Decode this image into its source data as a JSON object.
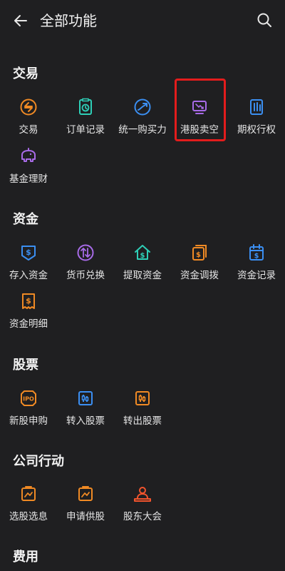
{
  "header": {
    "title": "全部功能"
  },
  "sections": {
    "trade": {
      "title": "交易",
      "items": [
        {
          "label": "交易",
          "icon": "swap-circle-icon",
          "color": "#f08a24"
        },
        {
          "label": "订单记录",
          "icon": "clock-doc-icon",
          "color": "#2ecfb7"
        },
        {
          "label": "统一购买力",
          "icon": "power-circle-icon",
          "color": "#3b8ff2"
        },
        {
          "label": "港股卖空",
          "icon": "short-chart-icon",
          "color": "#a86be8"
        },
        {
          "label": "期权行权",
          "icon": "option-exercise-icon",
          "color": "#3b8ff2"
        },
        {
          "label": "基金理财",
          "icon": "fund-piggy-icon",
          "color": "#a86be8"
        }
      ]
    },
    "funds": {
      "title": "资金",
      "items": [
        {
          "label": "存入资金",
          "icon": "deposit-icon",
          "color": "#3b8ff2"
        },
        {
          "label": "货币兑换",
          "icon": "currency-exchange-icon",
          "color": "#a86be8"
        },
        {
          "label": "提取资金",
          "icon": "withdraw-house-icon",
          "color": "#2ecfb7"
        },
        {
          "label": "资金调拨",
          "icon": "transfer-icon",
          "color": "#f08a24"
        },
        {
          "label": "资金记录",
          "icon": "calendar-dollar-icon",
          "color": "#3b8ff2"
        },
        {
          "label": "资金明细",
          "icon": "dollar-doc-icon",
          "color": "#f08a24"
        }
      ]
    },
    "stocks": {
      "title": "股票",
      "items": [
        {
          "label": "新股申购",
          "icon": "ipo-icon",
          "color": "#f08a24"
        },
        {
          "label": "转入股票",
          "icon": "stock-in-icon",
          "color": "#3b8ff2"
        },
        {
          "label": "转出股票",
          "icon": "stock-out-icon",
          "color": "#f08a24"
        }
      ]
    },
    "corporate": {
      "title": "公司行动",
      "items": [
        {
          "label": "选股选息",
          "icon": "chart-doc-icon",
          "color": "#f08a24"
        },
        {
          "label": "申请供股",
          "icon": "chart-doc-icon",
          "color": "#f08a24"
        },
        {
          "label": "股东大会",
          "icon": "meeting-icon",
          "color": "#f2542d"
        }
      ]
    },
    "fees": {
      "title": "费用"
    }
  }
}
